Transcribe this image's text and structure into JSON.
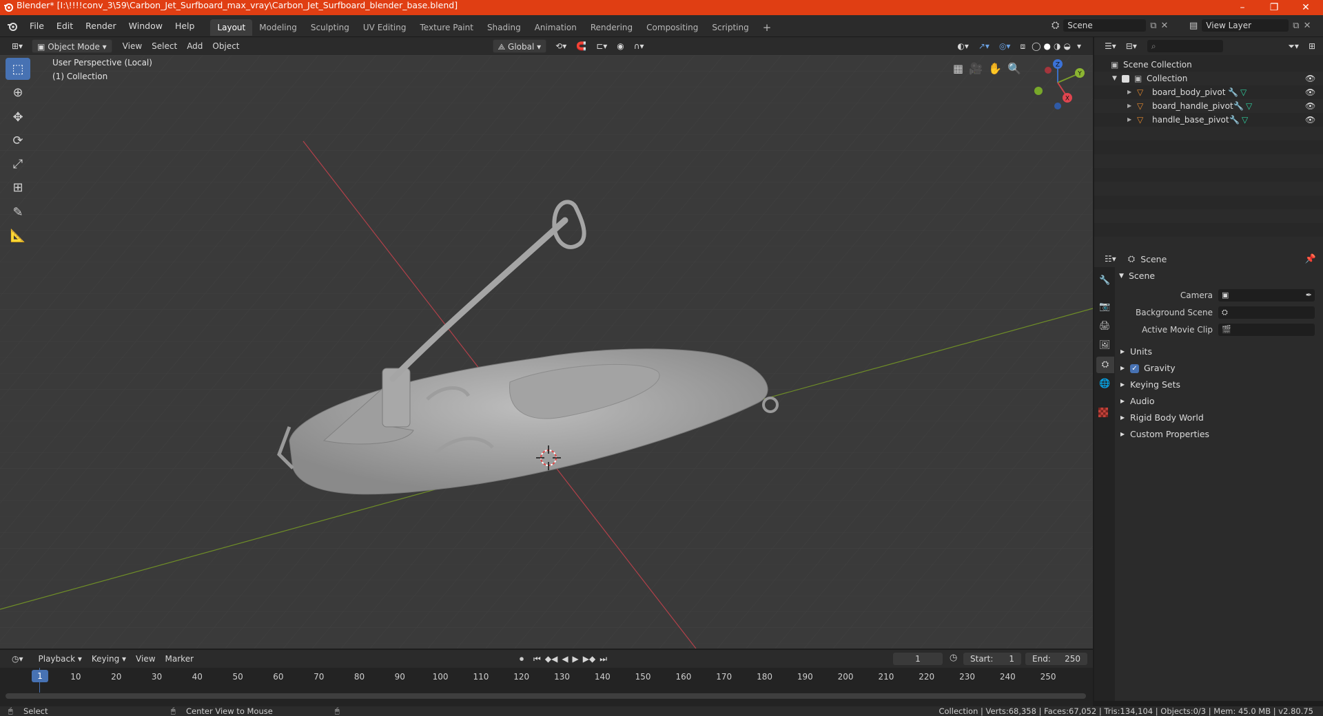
{
  "window": {
    "title": "Blender* [I:\\!!!!conv_3\\59\\Carbon_Jet_Surfboard_max_vray\\Carbon_Jet_Surfboard_blender_base.blend]",
    "minimize": "–",
    "maximize": "❐",
    "close": "✕"
  },
  "menu": [
    "File",
    "Edit",
    "Render",
    "Window",
    "Help"
  ],
  "workspaces": [
    "Layout",
    "Modeling",
    "Sculpting",
    "UV Editing",
    "Texture Paint",
    "Shading",
    "Animation",
    "Rendering",
    "Compositing",
    "Scripting"
  ],
  "workspace_add": "+",
  "scene_selector": "Scene",
  "view_layer_selector": "View Layer",
  "viewport_header": {
    "mode": "Object Mode",
    "view": "View",
    "select": "Select",
    "add": "Add",
    "object": "Object",
    "transform_orientation": "Global"
  },
  "viewport": {
    "perspective_label": "User Perspective (Local)",
    "collection_label": "(1) Collection",
    "gizmo": {
      "z": "Z",
      "y": "Y",
      "x": "X"
    }
  },
  "outliner": {
    "search_placeholder": "",
    "rows": [
      {
        "label": "Scene Collection"
      },
      {
        "label": "Collection"
      },
      {
        "label": "board_body_pivot"
      },
      {
        "label": "board_handle_pivot"
      },
      {
        "label": "handle_base_pivot"
      }
    ]
  },
  "properties": {
    "header_title": "Scene",
    "section_title": "Scene",
    "camera_label": "Camera",
    "background_scene_label": "Background Scene",
    "active_movie_clip_label": "Active Movie Clip",
    "subsections": [
      "Units",
      "Gravity",
      "Keying Sets",
      "Audio",
      "Rigid Body World",
      "Custom Properties"
    ]
  },
  "timeline": {
    "playback": "Playback",
    "keying": "Keying",
    "view": "View",
    "marker": "Marker",
    "current_frame": "1",
    "start_label": "Start:",
    "start_value": "1",
    "end_label": "End:",
    "end_value": "250",
    "ticks": [
      "10",
      "20",
      "30",
      "40",
      "50",
      "60",
      "70",
      "80",
      "90",
      "100",
      "110",
      "120",
      "130",
      "140",
      "150",
      "160",
      "170",
      "180",
      "190",
      "200",
      "210",
      "220",
      "230",
      "240",
      "250"
    ],
    "cursor_frame": "1"
  },
  "statusbar": {
    "left_action": "Select",
    "middle_action": "Center View to Mouse",
    "stats": "Collection | Verts:68,358 | Faces:67,052 | Tris:134,104 | Objects:0/3 | Mem: 45.0 MB | v2.80.75"
  },
  "colors": {
    "title_bar": "#e03e13",
    "accent": "#4772b3",
    "x_axis": "#c8434b",
    "y_axis": "#7b9c2a"
  }
}
